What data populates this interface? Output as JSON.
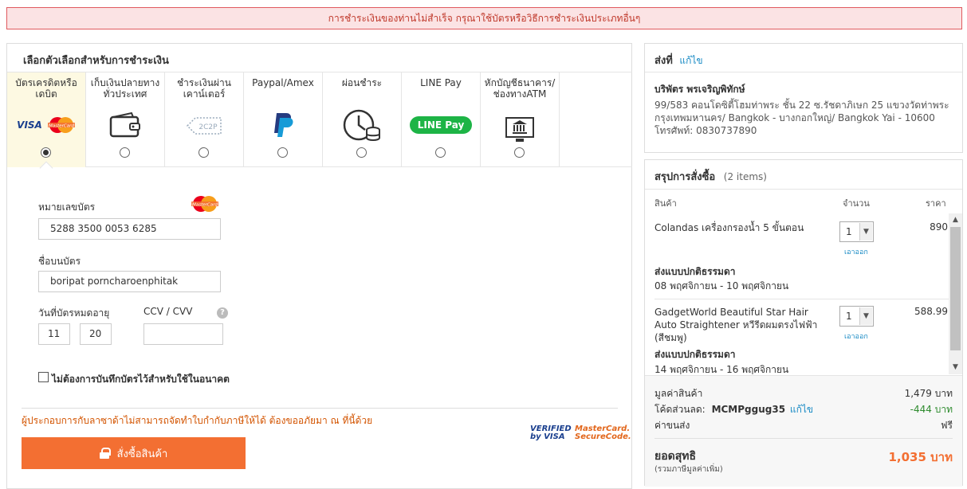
{
  "alert": {
    "message": "การชำระเงินของท่านไม่สำเร็จ กรุณาใช้บัตรหรือวิธีการชำระเงินประเภทอื่นๆ"
  },
  "payment": {
    "title": "เลือกตัวเลือกสำหรับการชำระเงิน",
    "methods": [
      {
        "label": "บัตรเครดิตหรือเดบิต",
        "icon": "visa-mastercard-icon",
        "selected": true
      },
      {
        "label": "เก็บเงินปลายทางทั่วประเทศ",
        "icon": "wallet-icon",
        "selected": false
      },
      {
        "label": "ชำระเงินผ่านเคาน์เตอร์",
        "icon": "2c2p-icon",
        "selected": false
      },
      {
        "label": "Paypal/Amex",
        "icon": "paypal-icon",
        "selected": false
      },
      {
        "label": "ผ่อนชำระ",
        "icon": "clock-coins-icon",
        "selected": false
      },
      {
        "label": "LINE Pay",
        "icon": "line-pay-icon",
        "selected": false
      },
      {
        "label": "หักบัญชีธนาคาร/ช่องทางATM",
        "icon": "bank-atm-icon",
        "selected": false
      }
    ],
    "visa_text": "VISA",
    "mastercard_text": "MasterCard",
    "linepay_text": "LINE Pay",
    "twoc2p_text": "2C2P",
    "card_number_label": "หมายเลขบัตร",
    "card_number": "5288 3500 0053 6285",
    "card_name_label": "ชื่อบนบัตร",
    "card_name": "boripat porncharoenphitak",
    "expiry_label": "วันที่บัตรหมดอายุ",
    "expiry_month": "11",
    "expiry_year": "20",
    "cvv_label": "CCV / CVV",
    "cvv_value": "",
    "help_text": "?",
    "save_card_label": "ไม่ต้องการบันทึกบัตรไว้สำหรับใช้ในอนาคต",
    "notice": "ผู้ประกอบการกับลาซาด้าไม่สามารถจัดทำใบกำกับภาษีให้ได้ ต้องขออภัยมา ณ ที่นี้ด้วย",
    "order_button": "สั่งซื้อสินค้า",
    "verified_visa": "VERIFIED by VISA",
    "mc_securecode": "MasterCard. SecureCode."
  },
  "shipping": {
    "title": "ส่งที่",
    "edit": "แก้ไข",
    "name": "บริพัตร พรเจริญพิทักษ์",
    "address_line1": "99/583 คอนโดซิตี้โฮมท่าพระ ชั้น 22 ซ.รัชดาภิเษก 25 แขวงวัดท่าพระ",
    "address_line2": "กรุงเทพมหานคร/ Bangkok - บางกอกใหญ่/ Bangkok Yai - 10600",
    "phone": "โทรศัพท์: 0830737890"
  },
  "summary": {
    "title": "สรุปการสั่งซื้อ",
    "count": "(2 items)",
    "col_product": "สินค้า",
    "col_qty": "จำนวน",
    "col_price": "ราคา",
    "items": [
      {
        "name": "Colandas เครื่องกรองน้ำ 5 ขั้นตอน",
        "qty": "1",
        "remove": "เอาออก",
        "price": "890",
        "ship_mode": "ส่งแบบปกติธรรมดา",
        "ship_date": "08 พฤศจิกายน - 10 พฤศจิกายน"
      },
      {
        "name": "GadgetWorld Beautiful Star Hair Auto Straightener หวีรีดผมตรงไฟฟ้า (สีชมพู)",
        "qty": "1",
        "remove": "เอาออก",
        "price": "588.99",
        "ship_mode": "ส่งแบบปกติธรรมดา",
        "ship_date": "14 พฤศจิกายน - 16 พฤศจิกายน"
      }
    ],
    "subtotal_label": "มูลค่าสินค้า",
    "subtotal": "1,479 บาท",
    "discount_label": "โค้ดส่วนลด:",
    "discount_code": "MCMPggug35",
    "discount_edit": "แก้ไข",
    "discount_value": "-444 บาท",
    "shipping_fee_label": "ค่าขนส่ง",
    "shipping_fee": "ฟรี",
    "net_label": "ยอดสุทธิ",
    "net_sub": "(รวมภาษีมูลค่าเพิ่ม)",
    "net_value": "1,035 บาท"
  },
  "colors": {
    "accent": "#f36f32",
    "link": "#1a8bc5",
    "alert_bg": "#fbe3e4",
    "alert_border": "#e05a5e"
  }
}
